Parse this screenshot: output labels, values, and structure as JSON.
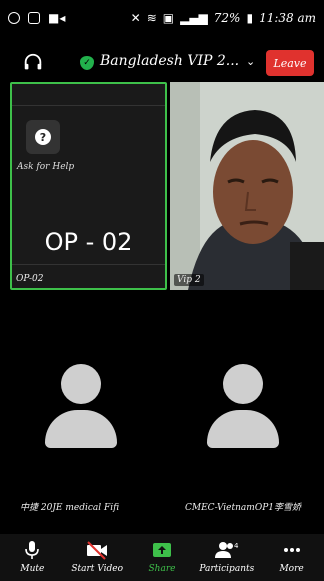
{
  "status_bar": {
    "battery": "72%",
    "time": "11:38 am"
  },
  "header": {
    "meeting_title": "Bangladesh VIP 2...",
    "leave_label": "Leave",
    "accent_secure": "#22b14c",
    "accent_leave": "#e0322e"
  },
  "tiles": {
    "tile_a": {
      "help_label": "Ask for Help",
      "display_name": "OP - 02",
      "name_tag": "OP-02"
    },
    "tile_b": {
      "name_tag": "Vip 2"
    },
    "tile_c": {
      "name": "中捷 20JE medical Fifi"
    },
    "tile_d": {
      "name": "CMEC-VietnamOP1李雪娇"
    }
  },
  "toolbar": {
    "mute": "Mute",
    "start_video": "Start Video",
    "share": "Share",
    "participants": "Participants",
    "participants_count": "4",
    "more": "More",
    "share_color": "#3ec04a"
  }
}
